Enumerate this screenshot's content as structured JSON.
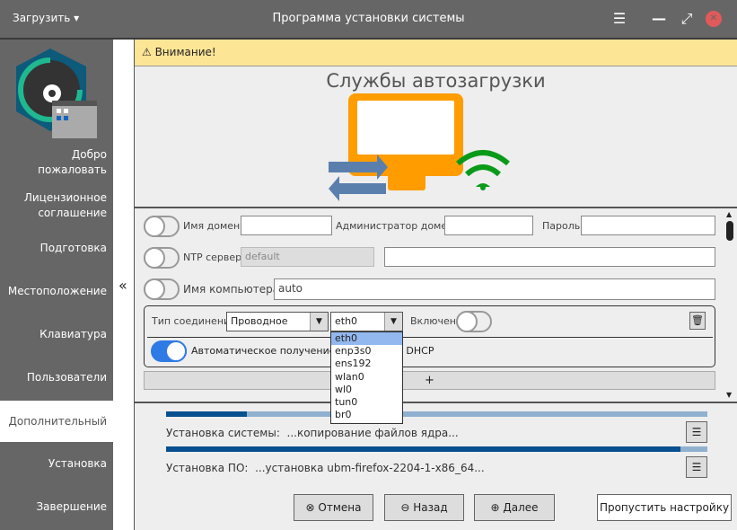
{
  "titlebar": {
    "load_menu": "Загрузить ▾",
    "title": "Программа установки системы",
    "menu_icon": "☰",
    "minimize_icon": "—",
    "maximize_icon": "⤢",
    "close_icon": "✕"
  },
  "sidebar": {
    "items": [
      {
        "label": "Добро пожаловать"
      },
      {
        "label": "Лицензионное соглашение"
      },
      {
        "label": "Подготовка"
      },
      {
        "label": "Местоположение"
      },
      {
        "label": "Клавиатура"
      },
      {
        "label": "Пользователи"
      },
      {
        "label": "Дополнительный",
        "active": true
      },
      {
        "label": "Установка"
      },
      {
        "label": "Завершение"
      }
    ],
    "collapse": "«"
  },
  "warning": {
    "text": "Внимание!"
  },
  "hero": {
    "title": "Службы автозагрузки"
  },
  "form": {
    "domain_label": "Имя домена:",
    "domain_value": "",
    "admin_label": "Администратор домена:",
    "admin_value": "",
    "password_label": "Пароль:",
    "password_value": "",
    "ntp_label": "NTP сервер:",
    "ntp_value": "default",
    "ntp_extra": "",
    "hostname_label": "Имя компьютера:",
    "hostname_value": "auto",
    "conn_type_label": "Тип соединения:",
    "conn_type_value": "Проводное",
    "iface_value": "eth0",
    "enabled_label": "Включен:",
    "dhcp_label": "Автоматическое получение IP-адреса по DHCP",
    "dhcp_visible_tail": "HCP",
    "add_label": "+",
    "iface_options": [
      "eth0",
      "enp3s0",
      "ens192",
      "wlan0",
      "wl0",
      "tun0",
      "br0"
    ]
  },
  "progress": {
    "system_label": "Установка системы:",
    "system_status": "...копирование файлов ядра...",
    "system_percent": 15,
    "software_label": "Установка ПО:",
    "software_status": "...установка ubm-firefox-2204-1-x86_64...",
    "software_percent": 95
  },
  "buttons": {
    "cancel": "Отмена",
    "back": "Назад",
    "next": "Далее",
    "skip": "Пропустить настройку"
  },
  "colors": {
    "accent": "#2f7ae5",
    "warning_bg": "#fde596",
    "progress": "#08508f",
    "monitor": "#ff9c00",
    "wifi": "#0a9a1a"
  }
}
